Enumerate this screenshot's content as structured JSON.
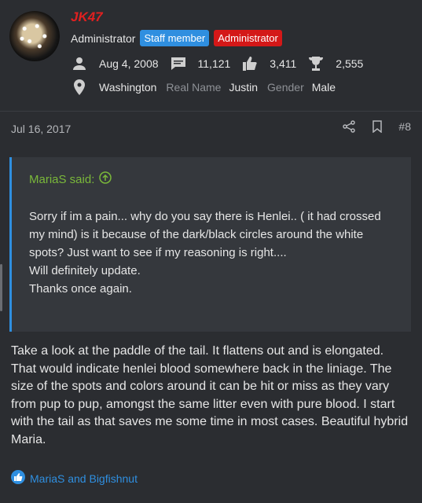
{
  "user": {
    "name": "JK47",
    "title": "Administrator",
    "badges": [
      "Staff member",
      "Administrator"
    ],
    "joined": "Aug 4, 2008",
    "messages": "11,121",
    "reactions": "3,411",
    "points": "2,555",
    "location": "Washington",
    "real_name_label": "Real Name",
    "real_name": "Justin",
    "gender_label": "Gender",
    "gender": "Male"
  },
  "post": {
    "date": "Jul 16, 2017",
    "number": "#8",
    "quote": {
      "author": "MariaS said:",
      "lines": [
        "Sorry if im a pain... why do you say there is Henlei.. ( it had crossed my mind) is it because of the dark/black circles around the white spots? Just want to see if my reasoning is right....",
        "Will definitely update.",
        "Thanks once again."
      ]
    },
    "message": "Take a look at the paddle of the tail. It flattens out and is elongated. That would indicate henlei blood somewhere back in the liniage. The size of the spots and colors around it can be hit or miss as they vary from pup to pup, amongst the same litter even with pure blood. I start with the tail as that saves me some time in most cases. Beautiful hybrid Maria.",
    "reactions_text": "MariaS and Bigfishnut"
  },
  "colors": {
    "background": "#2b2d31",
    "username": "#e02020",
    "staff_badge": "#2f8fe0",
    "admin_badge": "#d41818",
    "quote_author": "#7ab83a",
    "link": "#2f8fe0"
  },
  "icons": [
    "user-icon",
    "message-icon",
    "thumbs-up-icon",
    "trophy-icon",
    "location-pin-icon",
    "share-icon",
    "bookmark-icon",
    "arrow-up-circle-icon",
    "like-reaction-icon"
  ]
}
